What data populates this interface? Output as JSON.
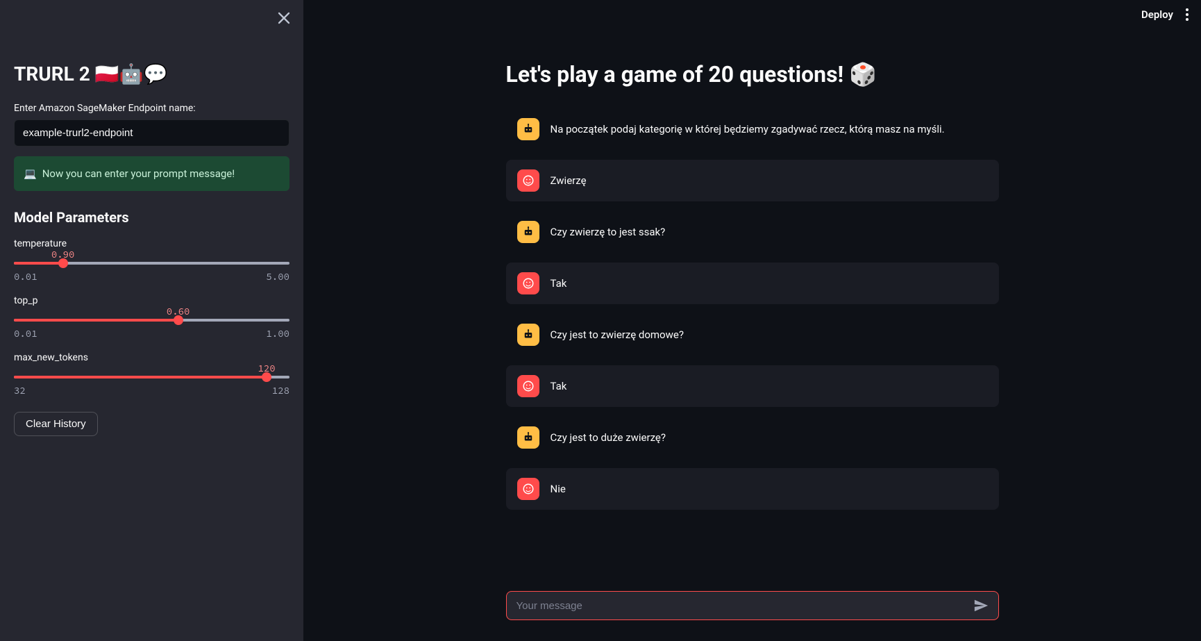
{
  "sidebar": {
    "title": "TRURL 2 🇵🇱🤖💬",
    "endpoint_label": "Enter Amazon SageMaker Endpoint name:",
    "endpoint_value": "example-trurl2-endpoint",
    "info_icon": "💻",
    "info_text": "Now you can enter your prompt message!",
    "params_header": "Model Parameters",
    "params": {
      "temperature": {
        "name": "temperature",
        "value": "0.90",
        "min": "0.01",
        "max": "5.00",
        "pct": 17.8
      },
      "top_p": {
        "name": "top_p",
        "value": "0.60",
        "min": "0.01",
        "max": "1.00",
        "pct": 59.6
      },
      "max_tokens": {
        "name": "max_new_tokens",
        "value": "120",
        "min": "32",
        "max": "128",
        "pct": 91.7
      }
    },
    "clear_label": "Clear History"
  },
  "topbar": {
    "deploy": "Deploy"
  },
  "chat": {
    "title": "Let's play a game of 20 questions! 🎲",
    "messages": [
      {
        "role": "bot",
        "text": "Na początek podaj kategorię w której będziemy zgadywać rzecz, którą masz na myśli."
      },
      {
        "role": "user",
        "text": "Zwierzę"
      },
      {
        "role": "bot",
        "text": "Czy zwierzę to jest ssak?"
      },
      {
        "role": "user",
        "text": "Tak"
      },
      {
        "role": "bot",
        "text": "Czy jest to zwierzę domowe?"
      },
      {
        "role": "user",
        "text": "Tak"
      },
      {
        "role": "bot",
        "text": "Czy jest to duże zwierzę?"
      },
      {
        "role": "user",
        "text": "Nie"
      }
    ],
    "input_placeholder": "Your message"
  }
}
